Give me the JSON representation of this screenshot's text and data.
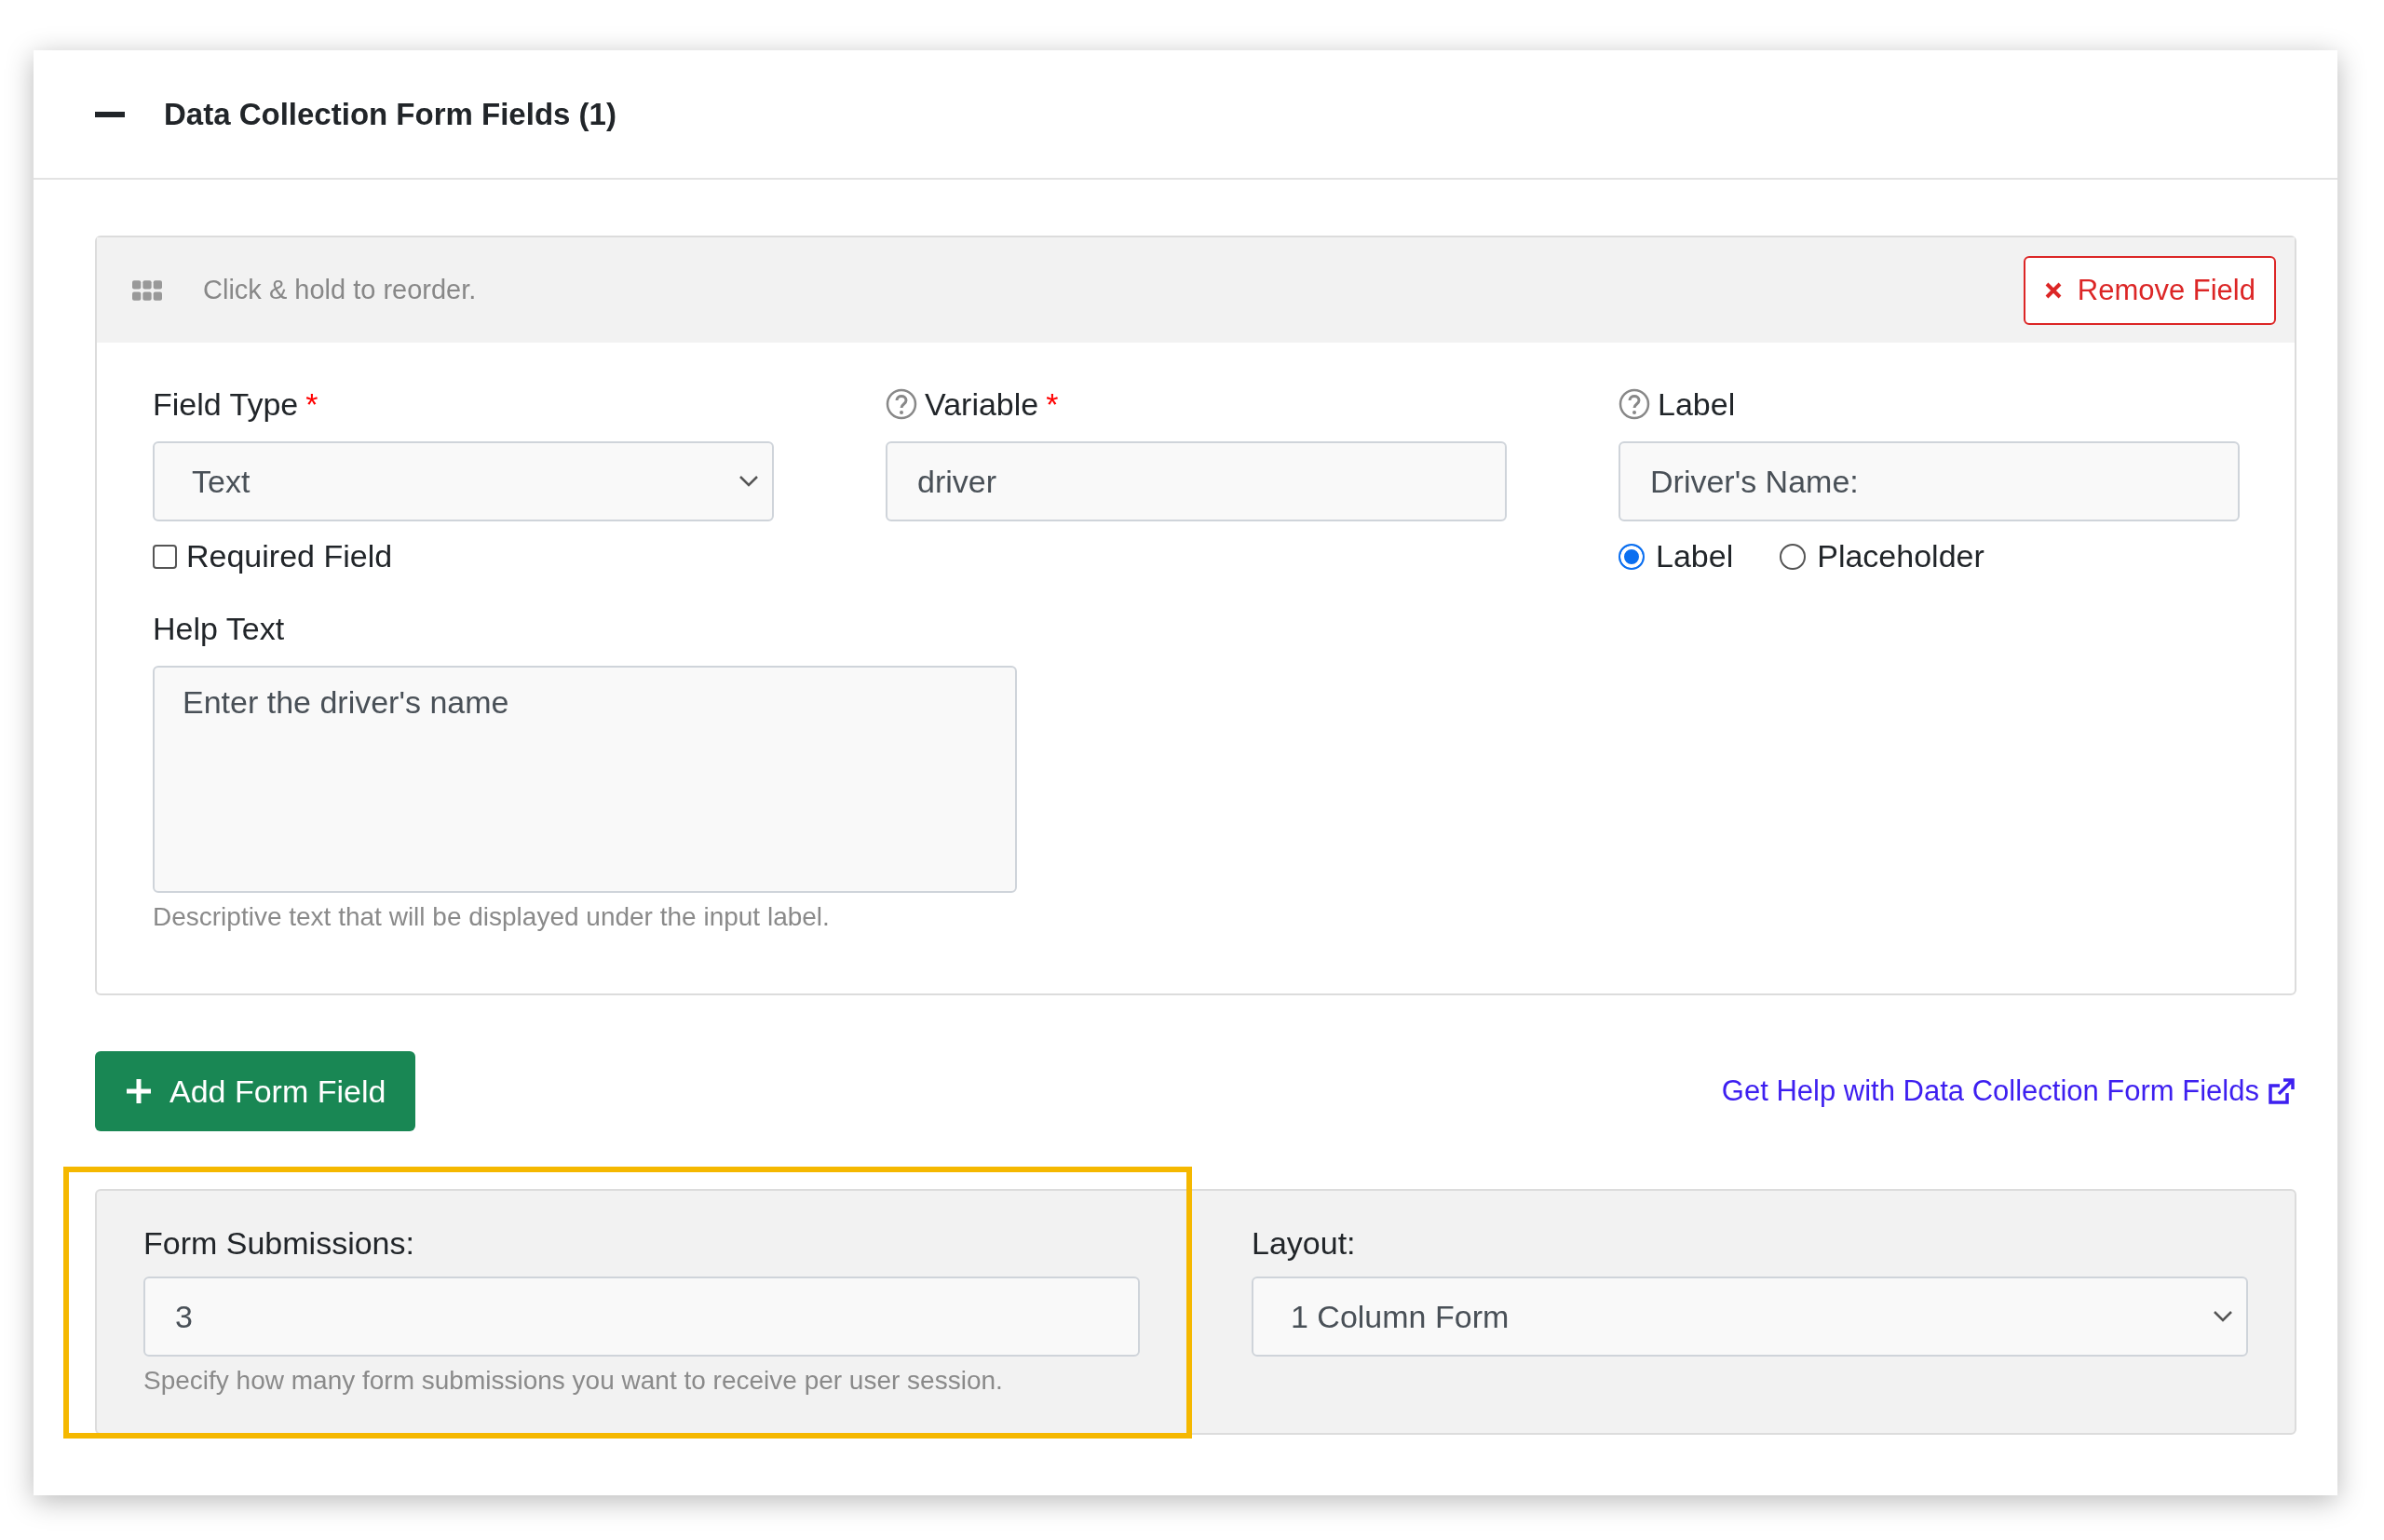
{
  "section": {
    "title": "Data Collection Form Fields (1)",
    "expanded": true
  },
  "field": {
    "reorder_hint": "Click & hold to reorder.",
    "remove_button": "Remove Field",
    "field_type": {
      "label": "Field Type",
      "required_mark": "*",
      "value": "Text"
    },
    "required_field": {
      "label": "Required Field",
      "checked": false
    },
    "variable": {
      "label": "Variable",
      "required_mark": "*",
      "help_icon": true,
      "value": "driver"
    },
    "label": {
      "label": "Label",
      "help_icon": true,
      "value": "Driver's Name:"
    },
    "label_mode": [
      {
        "label": "Label",
        "selected": true
      },
      {
        "label": "Placeholder",
        "selected": false
      }
    ],
    "help_text": {
      "label": "Help Text",
      "value": "Enter the driver's name",
      "hint": "Descriptive text that will be displayed under the input label."
    }
  },
  "add_button": "Add Form Field",
  "help_link": "Get Help with Data Collection Form Fields",
  "form_submissions": {
    "label": "Form Submissions:",
    "value": "3",
    "hint": "Specify how many form submissions you want to receive per user session.",
    "highlighted": true
  },
  "layout": {
    "label": "Layout:",
    "value": "1 Column Form"
  }
}
